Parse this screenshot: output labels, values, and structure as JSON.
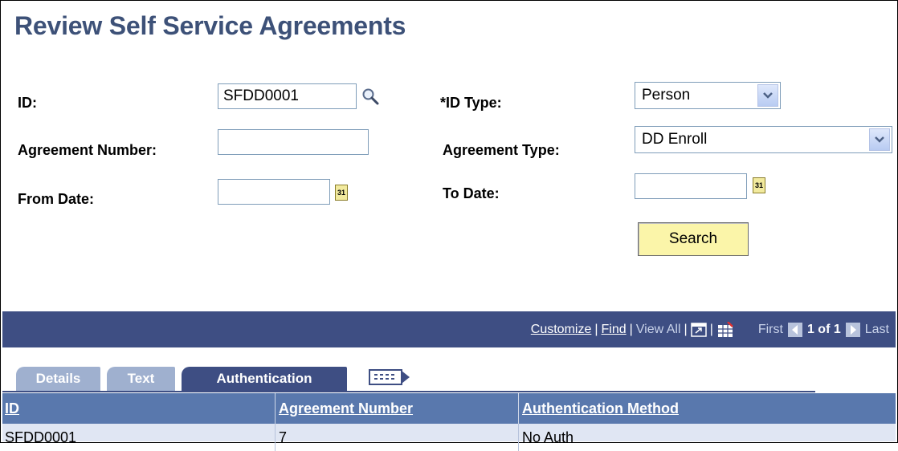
{
  "page": {
    "title": "Review Self Service Agreements"
  },
  "form": {
    "id_label": "ID:",
    "id_value": "SFDD0001",
    "id_type_label": "*ID Type:",
    "id_type_value": "Person",
    "agreement_number_label": "Agreement Number:",
    "agreement_number_value": "",
    "agreement_type_label": "Agreement Type:",
    "agreement_type_value": "DD Enroll",
    "from_date_label": "From Date:",
    "from_date_value": "",
    "to_date_label": "To Date:",
    "to_date_value": "",
    "calendar_glyph": "31",
    "search_button": "Search"
  },
  "grid": {
    "customize": "Customize",
    "find": "Find",
    "view_all": "View All",
    "first": "First",
    "page_count": "1 of 1",
    "last": "Last",
    "tabs": [
      "Details",
      "Text",
      "Authentication"
    ],
    "columns": [
      "ID",
      "Agreement Number",
      "Authentication Method"
    ],
    "rows": [
      {
        "id": "SFDD0001",
        "agreement_number": "7",
        "auth_method": "No Auth"
      }
    ]
  },
  "colors": {
    "title": "#3d5178",
    "grid_header": "#3e4e83",
    "column_header": "#5978ad",
    "row": "#e0e6f3",
    "button": "#fbf5a9"
  }
}
